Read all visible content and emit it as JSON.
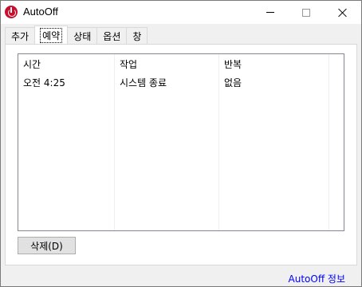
{
  "window": {
    "title": "AutoOff"
  },
  "tabs": [
    {
      "label": "추가",
      "active": false
    },
    {
      "label": "예약",
      "active": true
    },
    {
      "label": "상태",
      "active": false
    },
    {
      "label": "옵션",
      "active": false
    },
    {
      "label": "창",
      "active": false
    }
  ],
  "list": {
    "columns": [
      "시간",
      "작업",
      "반복"
    ],
    "rows": [
      [
        "오전 4:25",
        "시스템 종료",
        "없음"
      ]
    ]
  },
  "buttons": {
    "delete_label": "삭제(D)"
  },
  "footer": {
    "about_link": "AutoOff 정보"
  },
  "icons": {
    "app": "power-icon",
    "minimize": "minimize-icon",
    "maximize": "maximize-icon",
    "close": "close-icon"
  },
  "colors": {
    "app_icon": "#c8102e",
    "link": "#0000ff"
  }
}
